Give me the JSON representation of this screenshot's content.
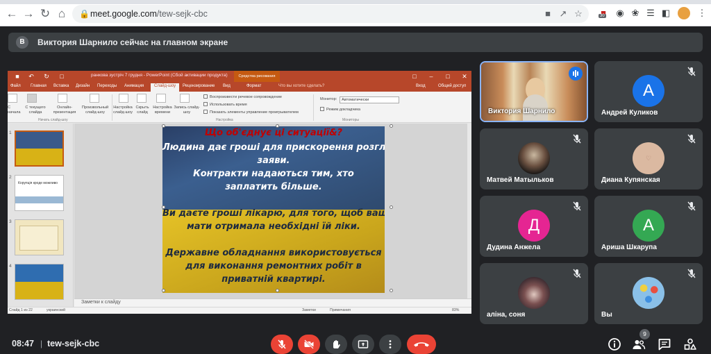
{
  "browser": {
    "url_host": "meet.google.com",
    "url_path": "/tew-sejk-cbc",
    "ext_badge": "30"
  },
  "banner": {
    "avatar_letter": "В",
    "text": "Виктория Шарнило сейчас на главном экране"
  },
  "presentation": {
    "window_title": "ранкова зустріч 7 грудня - PowerPoint (Сбой активации продукта)",
    "context_tab": "Средства рисования",
    "tabs": [
      "Файл",
      "Главная",
      "Вставка",
      "Дизайн",
      "Переходы",
      "Анимация",
      "Слайд-шоу",
      "Рецензирование",
      "Вид",
      "Формат"
    ],
    "tell_me": "Что вы хотите сделать?",
    "sign_in": "Вход",
    "share": "Общий доступ",
    "ribbon": {
      "btn_from_start": "С начала",
      "btn_from_current": "С текущего слайда",
      "btn_online": "Онлайн-презентация",
      "btn_custom": "Произвольный слайд-шоу",
      "btn_setup": "Настройка слайд-шоу",
      "btn_hide": "Скрыть слайд",
      "btn_rehearse": "Настройка времени",
      "btn_record": "Запись слайд-шоу",
      "chk_narration": "Воспроизвести речевое сопровождение",
      "chk_timings": "Использовать время",
      "chk_controls": "Показать элементы управление проигрывателем",
      "monitor_label": "Монитор:",
      "monitor_value": "Автоматически",
      "chk_presenter": "Режим докладчика",
      "group_start": "Начать слайд-шоу",
      "group_setup": "Настройка",
      "group_monitors": "Мониторы"
    },
    "thumbnails": [
      {
        "num": "1",
        "text": ""
      },
      {
        "num": "2",
        "text": "Корупція кроде можливо"
      },
      {
        "num": "3",
        "text": ""
      },
      {
        "num": "4",
        "text": ""
      }
    ],
    "slide_lines": [
      "Що об'єднує ці ситуації&?",
      "Людина дає гроші для прискорення розгляду",
      "заяви.",
      "Контракти надаються тим, хто",
      "заплатить більше.",
      "Ви даєте гроші лікарю, для того, щоб ваша",
      "мати отримала необхідні їй ліки.",
      "Державне обладнання використовується",
      "для виконання ремонтних робіт в",
      "приватній квартирі."
    ],
    "notes_placeholder": "Заметки к слайду",
    "status_slide": "Слайд 1 из 22",
    "status_lang": "украинский",
    "status_notes": "Заметки",
    "status_comments": "Примечания",
    "zoom": "83%"
  },
  "participants": [
    {
      "name": "Виктория Шарнило",
      "type": "video",
      "speaking": true
    },
    {
      "name": "Андрей Куликов",
      "letter": "А",
      "color": "#1a73e8",
      "muted": true
    },
    {
      "name": "Матвей Матыльков",
      "type": "photo",
      "color": "#7a6a5a",
      "muted": true
    },
    {
      "name": "Диана Купянская",
      "type": "photo",
      "color": "#d9b8a0",
      "muted": true
    },
    {
      "name": "Дудина Анжела",
      "letter": "Д",
      "color": "#e52592",
      "muted": true
    },
    {
      "name": "Ариша Шкарупа",
      "letter": "А",
      "color": "#34a853",
      "muted": true
    },
    {
      "name": "аліна, соня",
      "type": "photo",
      "color": "#5a4a50",
      "muted": true
    },
    {
      "name": "Вы",
      "type": "photo",
      "color": "#e8a040",
      "muted": true
    }
  ],
  "bottom_bar": {
    "time": "08:47",
    "separator": "|",
    "meeting_code": "tew-sejk-cbc",
    "people_count": "9"
  },
  "colors": {
    "background": "#202124",
    "tile": "#3c4043",
    "danger": "#ea4335",
    "accent": "#8ab4f8"
  }
}
